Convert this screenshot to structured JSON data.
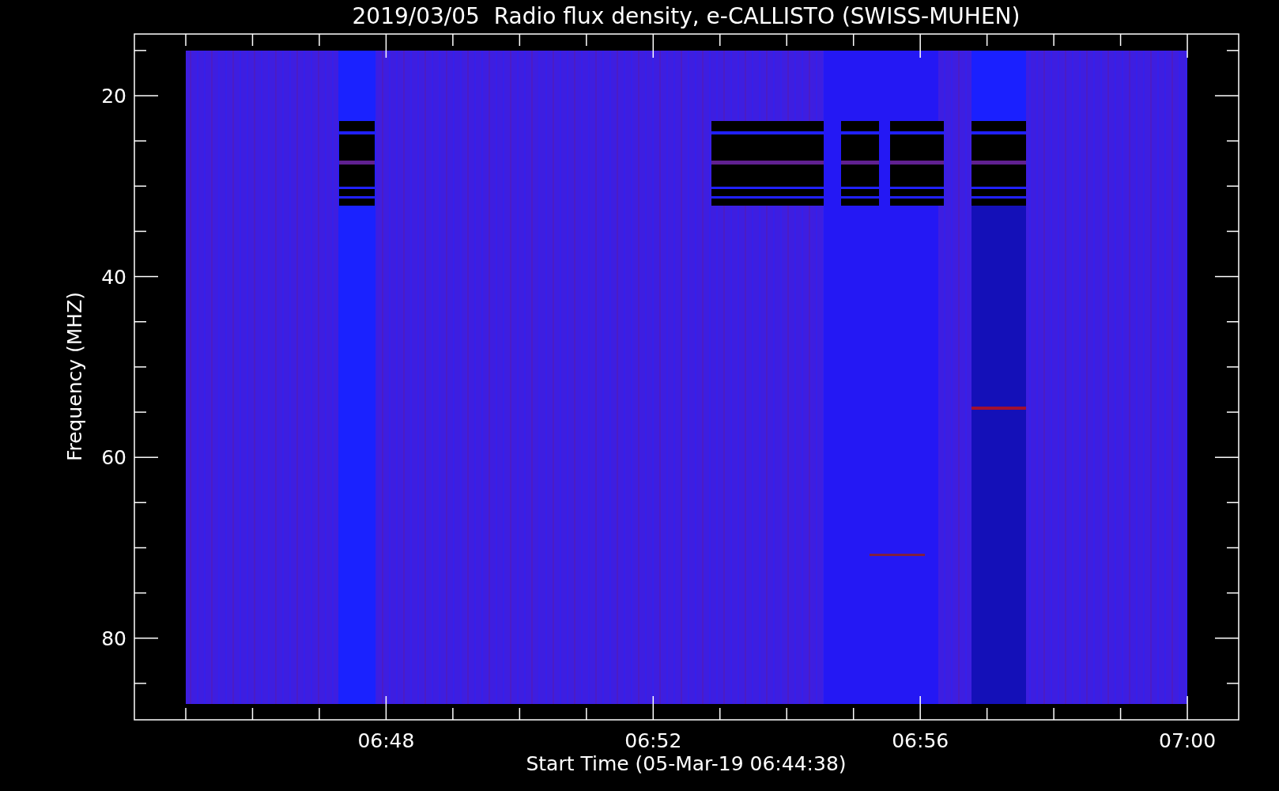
{
  "title": "2019/03/05  Radio flux density, e-CALLISTO (SWISS-MUHEN)",
  "y_axis": {
    "label": "Frequency (MHZ)",
    "tick_labels": [
      "20",
      "40",
      "60",
      "80"
    ]
  },
  "x_axis": {
    "label": "Start Time (05-Mar-19 06:44:38)",
    "tick_labels": [
      "06:48",
      "06:52",
      "06:56",
      "07:00"
    ]
  }
}
